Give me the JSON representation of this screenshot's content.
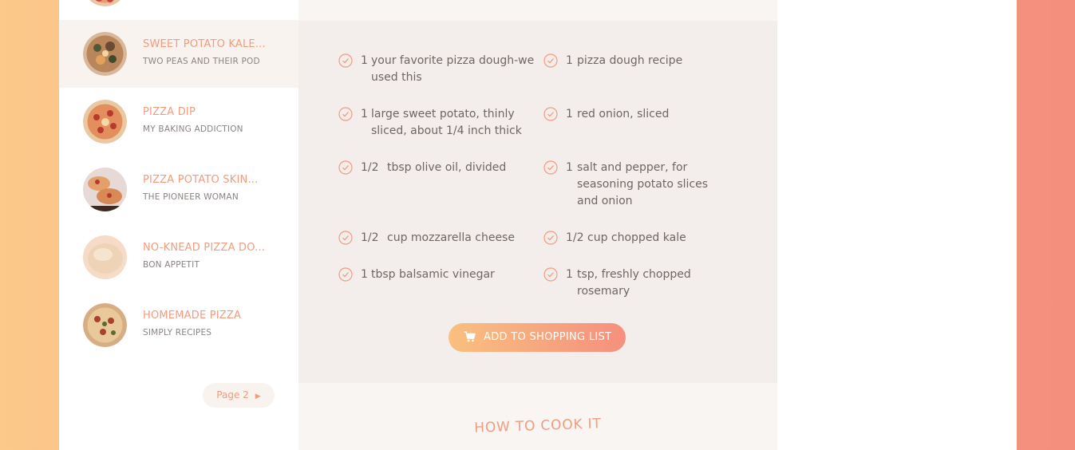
{
  "sidebar": {
    "items": [
      {
        "title": "SWEET POTATO KALE...",
        "source": "TWO PEAS AND THEIR POD",
        "active": true
      },
      {
        "title": "PIZZA DIP",
        "source": "MY BAKING ADDICTION",
        "active": false
      },
      {
        "title": "PIZZA POTATO SKIN...",
        "source": "THE PIONEER WOMAN",
        "active": false
      },
      {
        "title": "NO-KNEAD PIZZA DO...",
        "source": "BON APPETIT",
        "active": false
      },
      {
        "title": "HOMEMADE PIZZA",
        "source": "SIMPLY RECIPES",
        "active": false
      }
    ],
    "pager": {
      "label": "Page 2",
      "arrow": "▶"
    }
  },
  "ingredients": [
    {
      "qty": "1",
      "text": "your favorite pizza dough-we used this"
    },
    {
      "qty": "1",
      "text": "pizza dough recipe"
    },
    {
      "qty": "1",
      "text": "large sweet potato, thinly sliced, about 1/4 inch thick"
    },
    {
      "qty": "1",
      "text": "red onion, sliced"
    },
    {
      "qty": "1/2",
      "text": "tbsp olive oil, divided"
    },
    {
      "qty": "1",
      "text": "salt and pepper, for seasoning potato slices and onion"
    },
    {
      "qty": "1/2",
      "text": "cup mozzarella cheese"
    },
    {
      "qty": "1/2",
      "text": "cup chopped kale"
    },
    {
      "qty": "1",
      "text": "tbsp balsamic vinegar"
    },
    {
      "qty": "1",
      "text": "tsp, freshly chopped rosemary"
    }
  ],
  "cart_button": {
    "label": "ADD TO SHOPPING LIST",
    "icon": "shopping-cart-icon"
  },
  "how_to_cook": {
    "heading": "HOW TO COOK IT"
  },
  "colors": {
    "accent": "#f19c7e",
    "active_bg": "#f9f3f0",
    "panel_bg": "#f3eeec",
    "text": "#6f6663"
  }
}
